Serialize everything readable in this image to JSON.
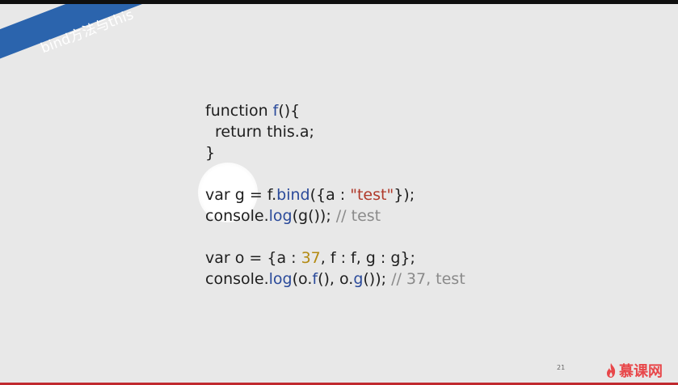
{
  "slide": {
    "title": "bind方法与this",
    "page_number": "21",
    "logo_text": "慕课网"
  },
  "code": {
    "l1_kw": "function ",
    "l1_fn": "f",
    "l1_rest": "(){",
    "l2": "return this.a;",
    "l3": "}",
    "l5_a": "var g = f.",
    "l5_fn": "bind",
    "l5_b": "({a : ",
    "l5_str": "\"test\"",
    "l5_c": "});",
    "l6_a": "console.",
    "l6_fn": "log",
    "l6_b": "(g()); ",
    "l6_cmt": "// test",
    "l8_a": "var o = {a : ",
    "l8_num": "37",
    "l8_b": ", f : f, g : g};",
    "l9_a": "console.",
    "l9_fn": "log",
    "l9_b": "(o.",
    "l9_f": "f",
    "l9_c": "(), o.",
    "l9_g": "g",
    "l9_d": "()); ",
    "l9_cmt": "// 37, test"
  },
  "colors": {
    "banner": "#2b64ad",
    "function_name": "#2a4a9a",
    "string": "#b0392a",
    "number": "#b38a11",
    "comment": "#8a8a8a",
    "logo": "#e8474a"
  },
  "icons": {
    "logo": "flame-icon"
  }
}
